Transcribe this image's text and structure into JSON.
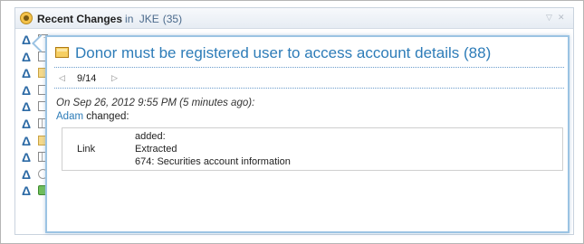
{
  "widget": {
    "title": "Recent Changes",
    "scope_prefix": "in",
    "scope": "JKE",
    "count": "(35)",
    "menu_glyph": "▽",
    "close_glyph": "✕"
  },
  "left_list": {
    "row_icon_glyph": "Δ",
    "rows": [
      {
        "sub_icon": "doc-lines-icon"
      },
      {
        "sub_icon": "doc-icon"
      },
      {
        "sub_icon": "folder-icon"
      },
      {
        "sub_icon": "doc-icon"
      },
      {
        "sub_icon": "doc-icon"
      },
      {
        "sub_icon": "grid-icon"
      },
      {
        "sub_icon": "folder-icon"
      },
      {
        "sub_icon": "grid-icon"
      },
      {
        "sub_icon": "oval-icon"
      },
      {
        "sub_icon": "green-icon"
      }
    ]
  },
  "popup": {
    "title": "Donor must be registered user to access account details (88)",
    "nav": {
      "prev_glyph": "◁",
      "position": "9/14",
      "next_glyph": "▷"
    },
    "change": {
      "when": "On Sep 26, 2012 9:55 PM (5 minutes ago):",
      "user": "Adam",
      "action": "changed:",
      "table": {
        "field": "Link",
        "lines": [
          "added:",
          "Extracted",
          "674: Securities account information"
        ]
      }
    }
  },
  "colors": {
    "accent": "#2d7cb8",
    "popup_border": "#9bc3e3",
    "widget_border": "#c9d3de"
  }
}
